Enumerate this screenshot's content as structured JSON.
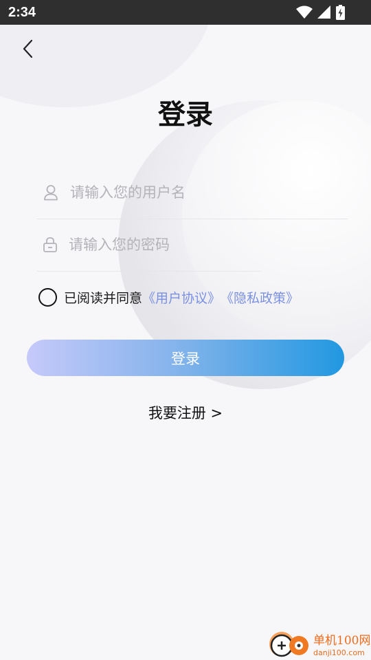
{
  "status_bar": {
    "time": "2:34",
    "icons": [
      "wifi-icon",
      "cellular-signal-icon",
      "battery-charging-icon"
    ]
  },
  "nav": {
    "back_icon": "chevron-left-icon"
  },
  "page": {
    "title": "登录"
  },
  "form": {
    "username": {
      "placeholder": "请输入您的用户名",
      "value": "",
      "icon": "user-icon"
    },
    "password": {
      "placeholder": "请输入您的密码",
      "value": "",
      "icon": "lock-icon"
    }
  },
  "agreement": {
    "checked": false,
    "text": "已阅读并同意",
    "user_agreement": "《用户协议》",
    "privacy_policy": "《隐私政策》"
  },
  "login_button": "登录",
  "register_link": "我要注册 >",
  "watermark": {
    "name": "单机100网",
    "url": "danji100.com"
  },
  "colors": {
    "link": "#7a90e2",
    "button_gradient_start": "#c6c9fa",
    "button_gradient_end": "#2198e1",
    "watermark": "#ef6a1a",
    "status_bar": "#2f2f2f"
  }
}
